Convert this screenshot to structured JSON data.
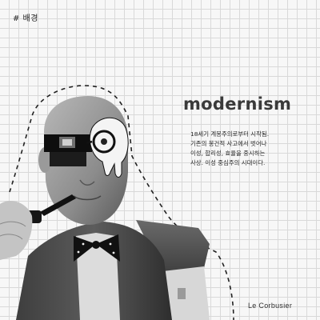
{
  "section_tag": "# 배경",
  "title": "modernism",
  "description_lines": [
    "18세기 계몽주의로부터 시작됨.",
    "기존의 봉건적 사고에서 벗어나",
    "이성, 합리성, 효율을 중시하는",
    "사상. 이성  중심주의  시대이다."
  ],
  "caption": "Le Corbusier",
  "colors": {
    "background": "#f7f7f7",
    "grid": "#d9d9d9",
    "text": "#2b2b2b"
  }
}
